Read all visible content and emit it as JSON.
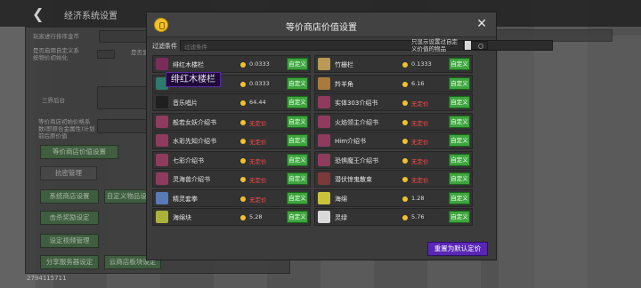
{
  "back_dialog": {
    "title": "经济系统设置",
    "labels": [
      {
        "text": "玩家进行排序金币"
      },
      {
        "text": "是否启用自定义系统物价初始化"
      },
      {
        "text": "三界后台"
      },
      {
        "text": "等价商店初始价格系数(即原合金属性)计划前后原价值"
      },
      {
        "text": "是否显示"
      }
    ],
    "buttons": [
      "等价商店价值设置",
      "抗密管理",
      "系统商店设置",
      "自定义物品设置",
      "击杀奖励设定",
      "设定视频管理",
      "分享服务器设定",
      "云商店板块设定"
    ],
    "id_text": "2794115711"
  },
  "modal": {
    "title": "等价商店价值设置",
    "close_label": "✕",
    "filter_label": "过滤条件",
    "filter_placeholder": "过滤条件",
    "only_custom_label": "只显示设置过自定义价值的物品",
    "tooltip": "绯红木楼栏",
    "reset_label": "重置为默认定价",
    "custom_btn": "自定义",
    "no_price": "无定价",
    "items_left": [
      {
        "name": "绯红木楼栏",
        "price": "0.0333",
        "color": "#7a2d5a"
      },
      {
        "name": "诡异木楼栏",
        "price": "0.0333",
        "color": "#2d7a6a"
      },
      {
        "name": "音乐唱片",
        "price": "64.44",
        "color": "#1f1f1f"
      },
      {
        "name": "般若女妖介绍书",
        "price": "无定价",
        "color": "#8e3b5e"
      },
      {
        "name": "水彩先知介绍书",
        "price": "无定价",
        "color": "#8e3b5e"
      },
      {
        "name": "七彩介绍书",
        "price": "无定价",
        "color": "#8e3b5e"
      },
      {
        "name": "灵海兽介绍书",
        "price": "无定价",
        "color": "#8e3b5e"
      },
      {
        "name": "精灵套拳",
        "price": "无定价",
        "color": "#5a7ab5"
      },
      {
        "name": "海绵块",
        "price": "5.28",
        "color": "#a9b33a"
      }
    ],
    "items_right": [
      {
        "name": "竹栅栏",
        "price": "0.1333",
        "color": "#b89a55"
      },
      {
        "name": "羚羊角",
        "price": "6.16",
        "color": "#a87a3d"
      },
      {
        "name": "实体303介绍书",
        "price": "无定价",
        "color": "#8e3b5e"
      },
      {
        "name": "火焰领主介绍书",
        "price": "无定价",
        "color": "#8e3b5e"
      },
      {
        "name": "Him介绍书",
        "price": "无定价",
        "color": "#8e3b5e"
      },
      {
        "name": "恐惧魔王介绍书",
        "price": "无定价",
        "color": "#8e3b5e"
      },
      {
        "name": "潜伏惊鬼散束",
        "price": "无定价",
        "color": "#7a3a3a"
      },
      {
        "name": "海绵",
        "price": "1.28",
        "color": "#c9c23a"
      },
      {
        "name": "灵绿",
        "price": "5.76",
        "color": "#d9d9d9"
      }
    ]
  }
}
